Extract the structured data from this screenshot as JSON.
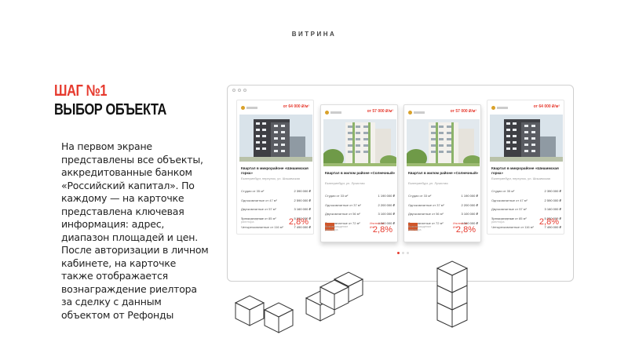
{
  "header": {
    "label": "ВИТРИНА"
  },
  "step": {
    "title": "ШАГ №1",
    "subtitle": "ВЫБОР ОБЪЕКТА",
    "description": "На первом экране представлены все объекты, аккредитованные банком «Российский капитал». По каждому — на карточке представлена ключевая информация: адрес, диапазон площадей и цен. После авторизации в личном кабинете, на карточке также отображается вознаграждение риелтора за сделку с данным объектом от Рефонды"
  },
  "cards": [
    {
      "price": "от 64 000 ₽/м²",
      "title": "Квартал в микрорайоне «Шишимская горка»",
      "address": "Екатеринбург, переулок, ул. Шишимская",
      "rows": [
        {
          "label": "Студии от 35 м²",
          "value": "2 390 000 ₽"
        },
        {
          "label": "Однокомнатные от 47 м²",
          "value": "2 590 000 ₽"
        },
        {
          "label": "Двухкомнатные от 57 м²",
          "value": "3 160 000 ₽"
        },
        {
          "label": "Трехкомнатные от 85 м²",
          "value": "5 530 000 ₽"
        },
        {
          "label": "Четырехкомнатные от 116 м²",
          "value": "7 490 000 ₽"
        }
      ],
      "foot_label": "Вознаграждение риелтора",
      "rate": "2,8%"
    },
    {
      "price": "от 57 000 ₽/м²",
      "title": "Квартал в жилом районе «Солнечный»",
      "address": "Екатеринбург, ул. Лучистая",
      "rows": [
        {
          "label": "Студии от 33 м²",
          "value": "1 190 000 ₽"
        },
        {
          "label": "Однокомнатные от 37 м²",
          "value": "2 200 000 ₽"
        },
        {
          "label": "Двухкомнатные от 56 м²",
          "value": "3 100 000 ₽"
        },
        {
          "label": "Трехкомнатные от 72 м²",
          "value": "4 560 000 ₽"
        }
      ],
      "badge_text": "Ипотека от 8%",
      "foot_label": "Вознаграждение риелтора",
      "rate": "2,8%"
    },
    {
      "price": "от 57 000 ₽/м²",
      "title": "Квартал в жилом районе «Солнечный»",
      "address": "Екатеринбург, ул. Лучистая",
      "rows": [
        {
          "label": "Студии от 33 м²",
          "value": "1 190 000 ₽"
        },
        {
          "label": "Однокомнатные от 37 м²",
          "value": "2 200 000 ₽"
        },
        {
          "label": "Двухкомнатные от 56 м²",
          "value": "3 100 000 ₽"
        },
        {
          "label": "Трехкомнатные от 72 м²",
          "value": "4 560 000 ₽"
        }
      ],
      "badge_text": "Ипотека от 8%",
      "foot_label": "Вознаграждение риелтора",
      "rate": "2,8%"
    },
    {
      "price": "от 64 000 ₽/м²",
      "title": "Квартал в микрорайоне «Шишимская горка»",
      "address": "Екатеринбург, переулок, ул. Шишимская",
      "rows": [
        {
          "label": "Студии от 35 м²",
          "value": "2 390 000 ₽"
        },
        {
          "label": "Однокомнатные от 47 м²",
          "value": "2 590 000 ₽"
        },
        {
          "label": "Двухкомнатные от 57 м²",
          "value": "3 160 000 ₽"
        },
        {
          "label": "Трехкомнатные от 85 м²",
          "value": "5 530 000 ₽"
        },
        {
          "label": "Четырехкомнатные от 116 м²",
          "value": "7 490 000 ₽"
        }
      ],
      "foot_label": "Вознаграждение риелтора",
      "rate": "2,8%"
    }
  ],
  "colors": {
    "accent": "#e63a2e",
    "text": "#222222",
    "frame": "#cfcfcf"
  }
}
